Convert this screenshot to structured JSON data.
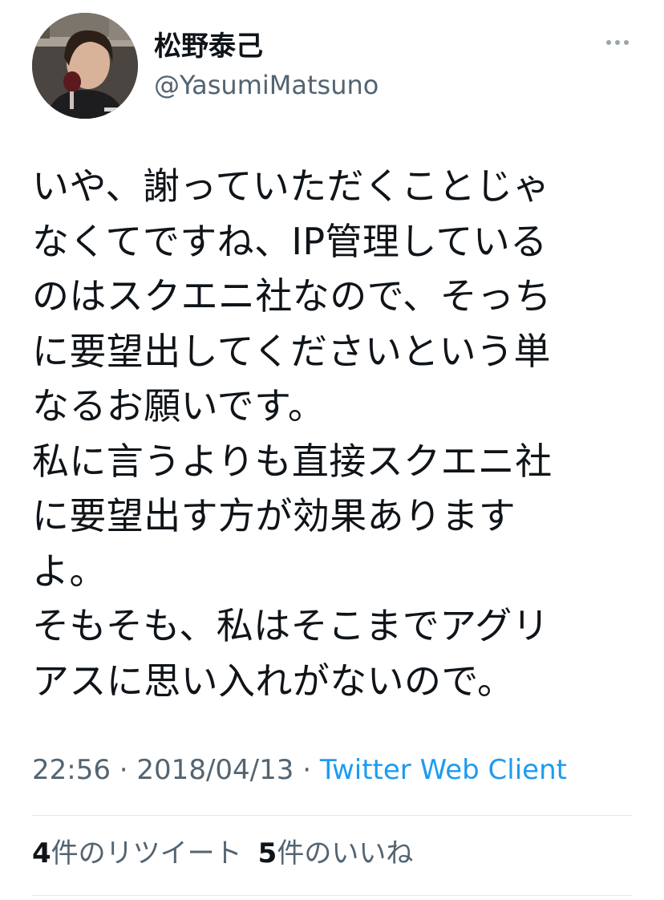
{
  "author": {
    "name": "松野泰己",
    "handle": "@YasumiMatsuno"
  },
  "more_icon": "more-horizontal-icon",
  "tweet_lines": [
    "いや、謝っていただくことじゃ",
    "なくてですね、IP管理している",
    "のはスクエニ社なので、そっち",
    "に要望出してくださいという単",
    "なるお願いです。",
    "私に言うよりも直接スクエニ社",
    "に要望出す方が効果あります",
    "よ。",
    "そもそも、私はそこまでアグリ",
    "アスに思い入れがないので。"
  ],
  "meta": {
    "time": "22:56",
    "separator": " · ",
    "date": "2018/04/13",
    "client": "Twitter Web Client"
  },
  "stats": {
    "retweet_count": "4",
    "retweet_label": "件のリツイート",
    "like_count": "5",
    "like_label": "件のいいね"
  },
  "colors": {
    "text": "#0f1419",
    "secondary": "#536471",
    "link": "#1d9bf0",
    "divider": "#e1e6ea"
  }
}
